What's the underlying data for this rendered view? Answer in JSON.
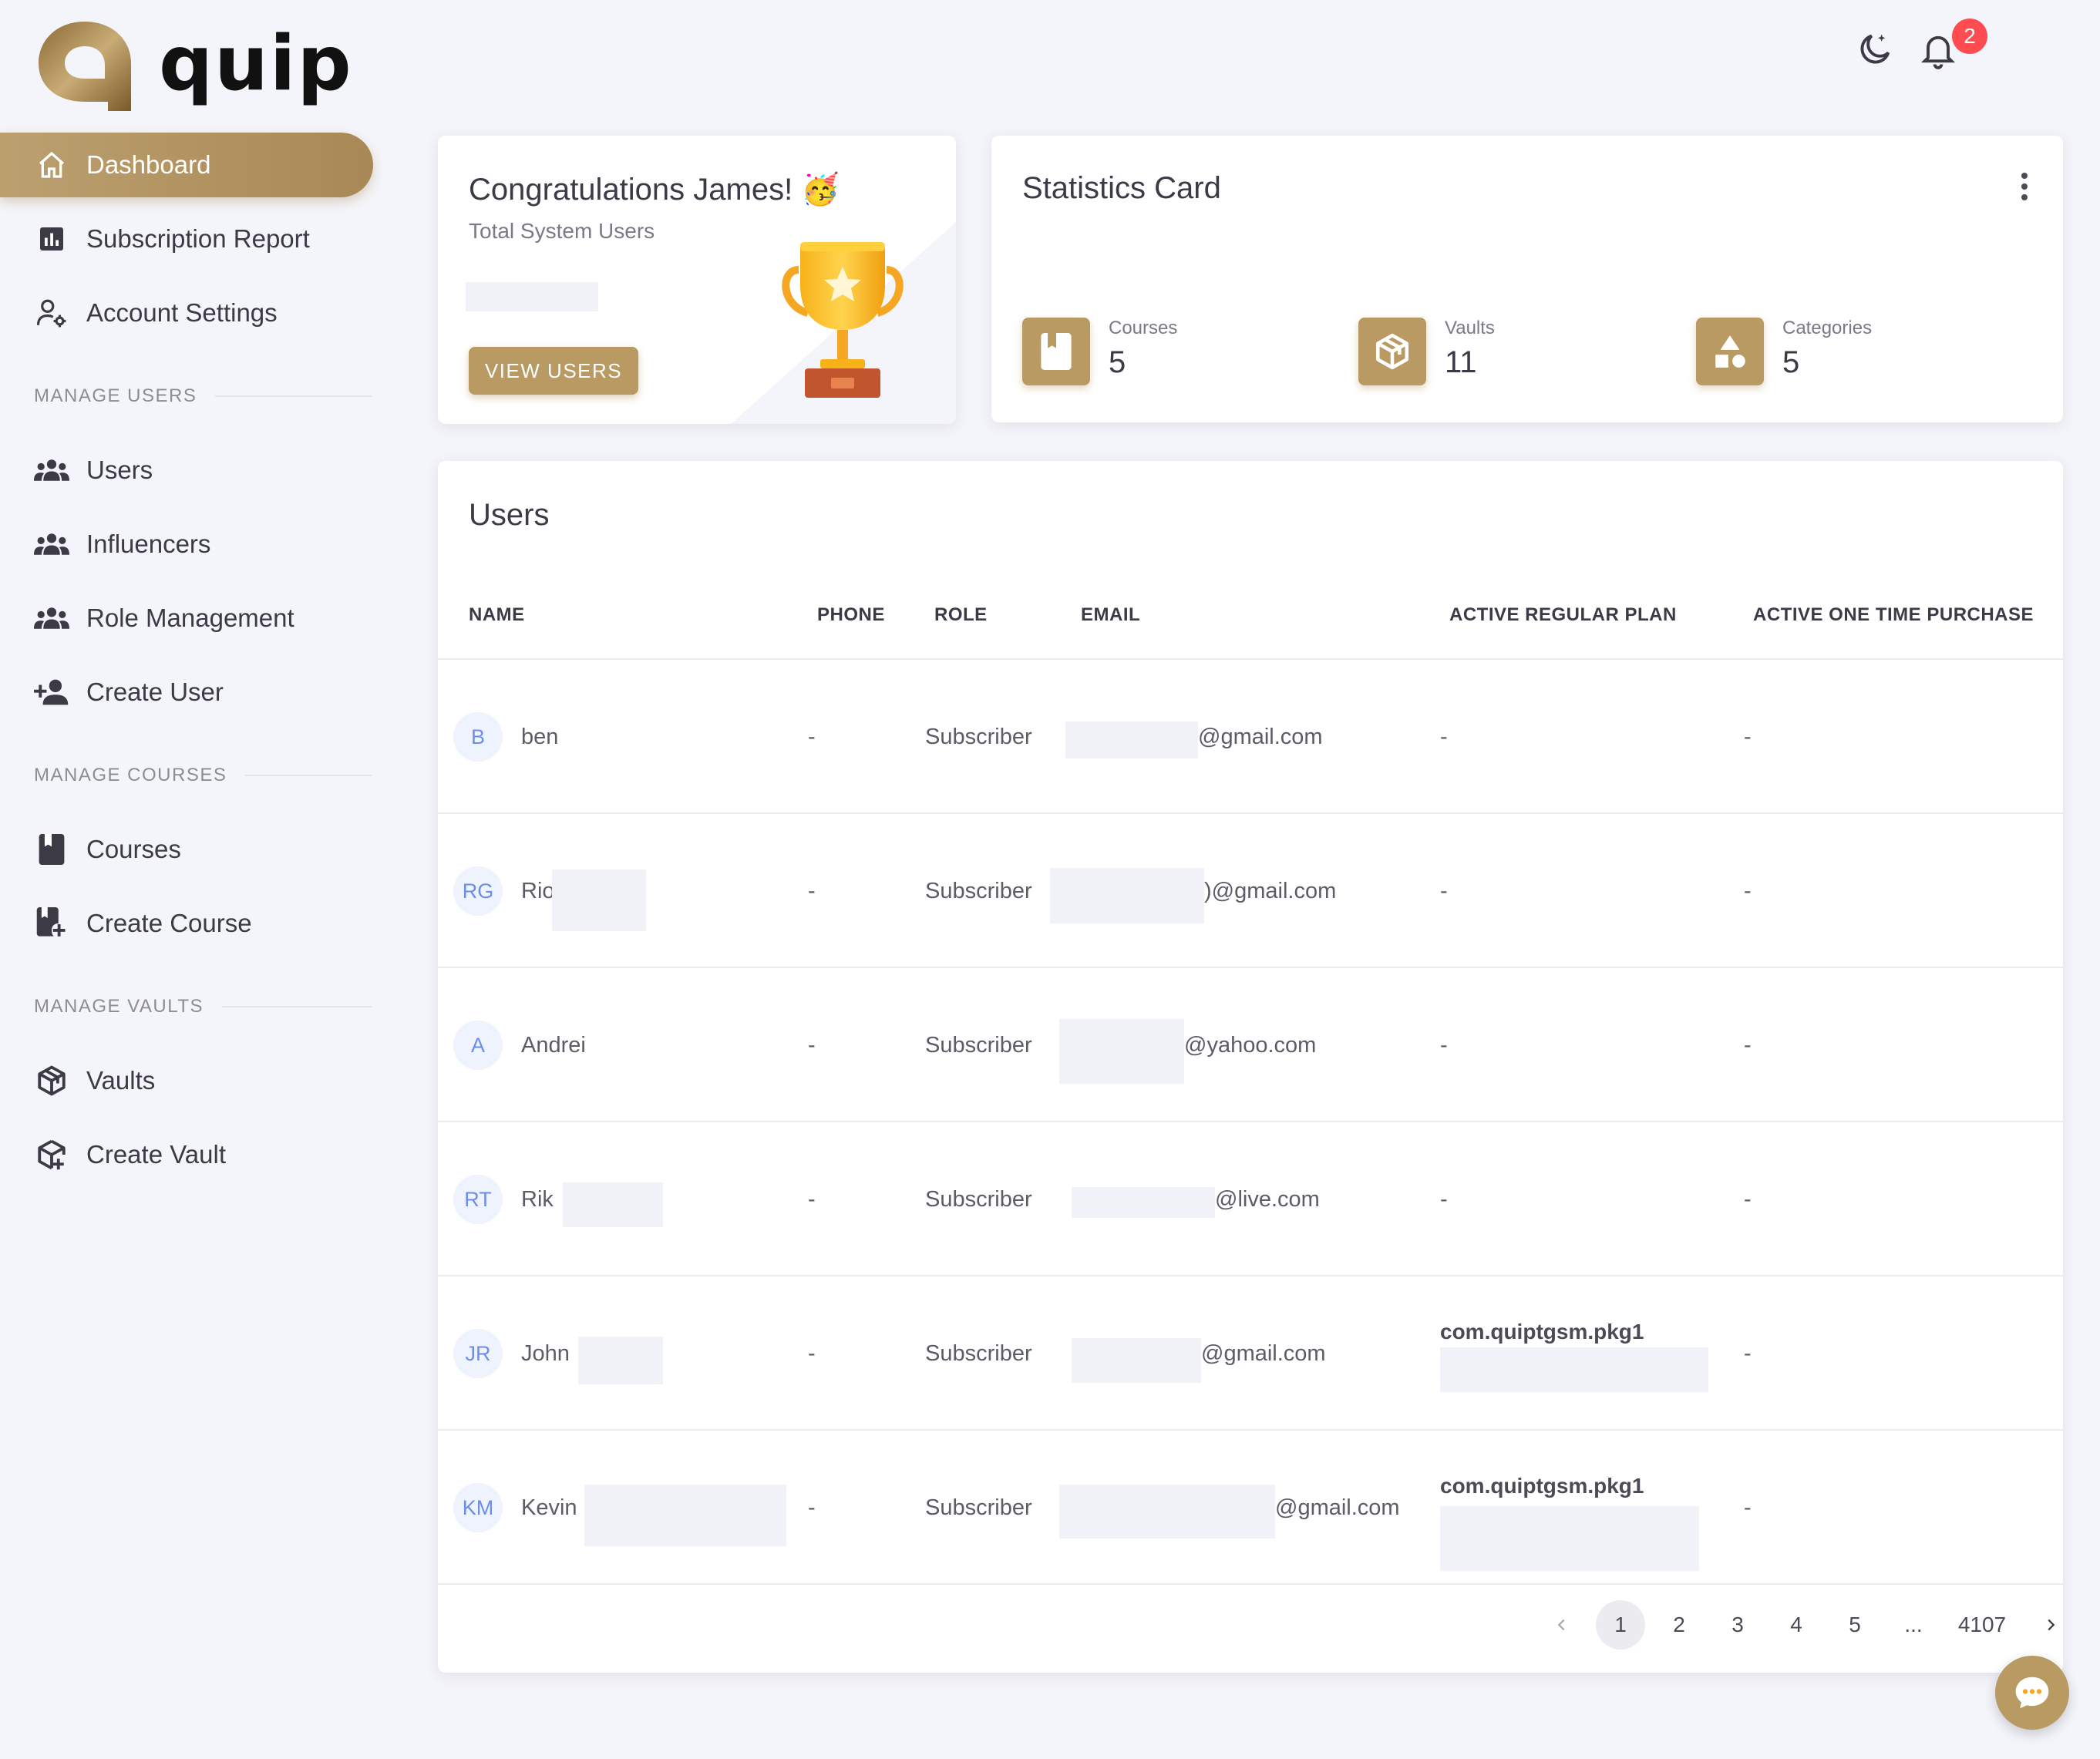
{
  "app": {
    "logo_text": "quip"
  },
  "sidebar": {
    "items": [
      {
        "label": "Dashboard",
        "icon": "home-icon",
        "active": true
      },
      {
        "label": "Subscription Report",
        "icon": "chart-icon"
      },
      {
        "label": "Account Settings",
        "icon": "user-gear-icon"
      }
    ],
    "manage_users": {
      "title": "MANAGE USERS",
      "items": [
        {
          "label": "Users",
          "icon": "users-group-icon"
        },
        {
          "label": "Influencers",
          "icon": "users-group-icon"
        },
        {
          "label": "Role Management",
          "icon": "users-group-icon"
        },
        {
          "label": "Create User",
          "icon": "user-plus-icon"
        }
      ]
    },
    "manage_courses": {
      "title": "MANAGE COURSES",
      "items": [
        {
          "label": "Courses",
          "icon": "book-icon"
        },
        {
          "label": "Create Course",
          "icon": "book-plus-icon"
        }
      ]
    },
    "manage_vaults": {
      "title": "MANAGE VAULTS",
      "items": [
        {
          "label": "Vaults",
          "icon": "cube-icon"
        },
        {
          "label": "Create Vault",
          "icon": "cube-plus-icon"
        }
      ]
    }
  },
  "topbar": {
    "notification_count": "2"
  },
  "congrats": {
    "title": "Congratulations James! 🥳",
    "subtitle": "Total System Users",
    "button": "VIEW USERS"
  },
  "stats": {
    "title": "Statistics Card",
    "items": [
      {
        "label": "Courses",
        "value": "5",
        "icon": "book-icon"
      },
      {
        "label": "Vaults",
        "value": "11",
        "icon": "cube-icon"
      },
      {
        "label": "Categories",
        "value": "5",
        "icon": "shapes-icon"
      }
    ]
  },
  "users": {
    "title": "Users",
    "columns": [
      "NAME",
      "PHONE",
      "ROLE",
      "EMAIL",
      "ACTIVE REGULAR PLAN",
      "ACTIVE ONE TIME PURCHASE"
    ],
    "rows": [
      {
        "initials": "B",
        "name": "ben",
        "phone": "-",
        "role": "Subscriber",
        "email": "@gmail.com",
        "plan": "-",
        "one_time": "-"
      },
      {
        "initials": "RG",
        "name": "Rio",
        "phone": "-",
        "role": "Subscriber",
        "email": ")@gmail.com",
        "plan": "-",
        "one_time": "-"
      },
      {
        "initials": "A",
        "name": "Andrei",
        "phone": "-",
        "role": "Subscriber",
        "email": "@yahoo.com",
        "plan": "-",
        "one_time": "-"
      },
      {
        "initials": "RT",
        "name": "Rik",
        "phone": "-",
        "role": "Subscriber",
        "email": "@live.com",
        "plan": "-",
        "one_time": "-"
      },
      {
        "initials": "JR",
        "name": "John",
        "phone": "-",
        "role": "Subscriber",
        "email": "@gmail.com",
        "plan": "com.quiptgsm.pkg1",
        "one_time": "-"
      },
      {
        "initials": "KM",
        "name": "Kevin",
        "phone": "-",
        "role": "Subscriber",
        "email": "@gmail.com",
        "plan": "com.quiptgsm.pkg1",
        "one_time": "-"
      }
    ],
    "pagination": [
      "1",
      "2",
      "3",
      "4",
      "5",
      "...",
      "4107"
    ]
  },
  "colors": {
    "accent": "#b89a62",
    "badge": "#ff4c51",
    "background": "#f4f5fa"
  }
}
